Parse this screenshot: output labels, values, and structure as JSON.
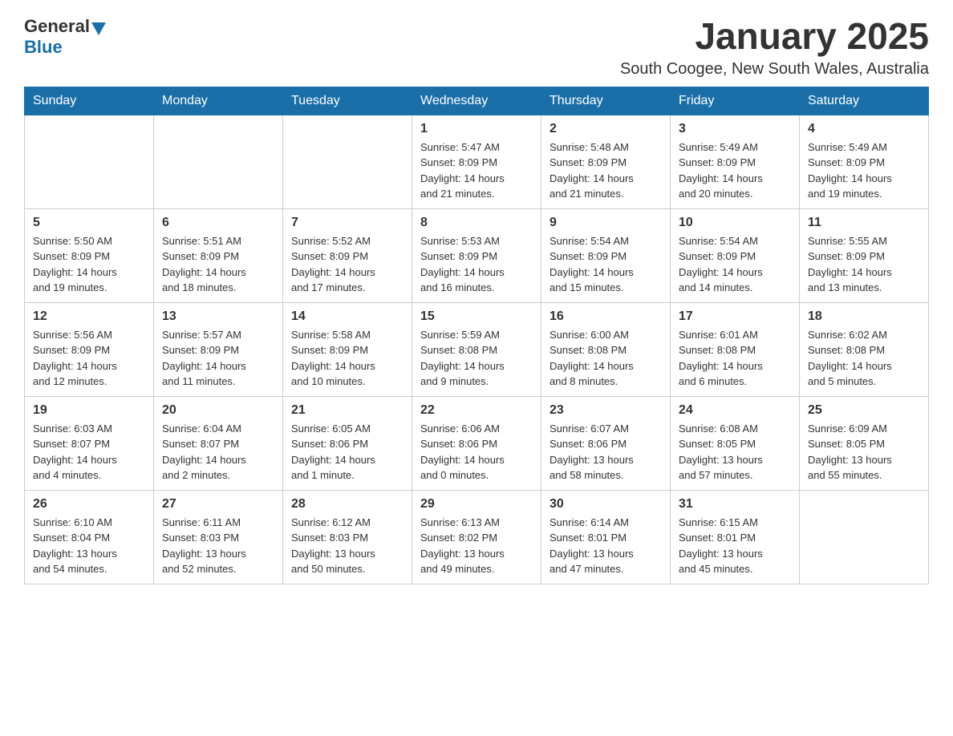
{
  "logo": {
    "general": "General",
    "blue": "Blue"
  },
  "title": "January 2025",
  "location": "South Coogee, New South Wales, Australia",
  "weekdays": [
    "Sunday",
    "Monday",
    "Tuesday",
    "Wednesday",
    "Thursday",
    "Friday",
    "Saturday"
  ],
  "weeks": [
    [
      {
        "day": "",
        "info": ""
      },
      {
        "day": "",
        "info": ""
      },
      {
        "day": "",
        "info": ""
      },
      {
        "day": "1",
        "info": "Sunrise: 5:47 AM\nSunset: 8:09 PM\nDaylight: 14 hours\nand 21 minutes."
      },
      {
        "day": "2",
        "info": "Sunrise: 5:48 AM\nSunset: 8:09 PM\nDaylight: 14 hours\nand 21 minutes."
      },
      {
        "day": "3",
        "info": "Sunrise: 5:49 AM\nSunset: 8:09 PM\nDaylight: 14 hours\nand 20 minutes."
      },
      {
        "day": "4",
        "info": "Sunrise: 5:49 AM\nSunset: 8:09 PM\nDaylight: 14 hours\nand 19 minutes."
      }
    ],
    [
      {
        "day": "5",
        "info": "Sunrise: 5:50 AM\nSunset: 8:09 PM\nDaylight: 14 hours\nand 19 minutes."
      },
      {
        "day": "6",
        "info": "Sunrise: 5:51 AM\nSunset: 8:09 PM\nDaylight: 14 hours\nand 18 minutes."
      },
      {
        "day": "7",
        "info": "Sunrise: 5:52 AM\nSunset: 8:09 PM\nDaylight: 14 hours\nand 17 minutes."
      },
      {
        "day": "8",
        "info": "Sunrise: 5:53 AM\nSunset: 8:09 PM\nDaylight: 14 hours\nand 16 minutes."
      },
      {
        "day": "9",
        "info": "Sunrise: 5:54 AM\nSunset: 8:09 PM\nDaylight: 14 hours\nand 15 minutes."
      },
      {
        "day": "10",
        "info": "Sunrise: 5:54 AM\nSunset: 8:09 PM\nDaylight: 14 hours\nand 14 minutes."
      },
      {
        "day": "11",
        "info": "Sunrise: 5:55 AM\nSunset: 8:09 PM\nDaylight: 14 hours\nand 13 minutes."
      }
    ],
    [
      {
        "day": "12",
        "info": "Sunrise: 5:56 AM\nSunset: 8:09 PM\nDaylight: 14 hours\nand 12 minutes."
      },
      {
        "day": "13",
        "info": "Sunrise: 5:57 AM\nSunset: 8:09 PM\nDaylight: 14 hours\nand 11 minutes."
      },
      {
        "day": "14",
        "info": "Sunrise: 5:58 AM\nSunset: 8:09 PM\nDaylight: 14 hours\nand 10 minutes."
      },
      {
        "day": "15",
        "info": "Sunrise: 5:59 AM\nSunset: 8:08 PM\nDaylight: 14 hours\nand 9 minutes."
      },
      {
        "day": "16",
        "info": "Sunrise: 6:00 AM\nSunset: 8:08 PM\nDaylight: 14 hours\nand 8 minutes."
      },
      {
        "day": "17",
        "info": "Sunrise: 6:01 AM\nSunset: 8:08 PM\nDaylight: 14 hours\nand 6 minutes."
      },
      {
        "day": "18",
        "info": "Sunrise: 6:02 AM\nSunset: 8:08 PM\nDaylight: 14 hours\nand 5 minutes."
      }
    ],
    [
      {
        "day": "19",
        "info": "Sunrise: 6:03 AM\nSunset: 8:07 PM\nDaylight: 14 hours\nand 4 minutes."
      },
      {
        "day": "20",
        "info": "Sunrise: 6:04 AM\nSunset: 8:07 PM\nDaylight: 14 hours\nand 2 minutes."
      },
      {
        "day": "21",
        "info": "Sunrise: 6:05 AM\nSunset: 8:06 PM\nDaylight: 14 hours\nand 1 minute."
      },
      {
        "day": "22",
        "info": "Sunrise: 6:06 AM\nSunset: 8:06 PM\nDaylight: 14 hours\nand 0 minutes."
      },
      {
        "day": "23",
        "info": "Sunrise: 6:07 AM\nSunset: 8:06 PM\nDaylight: 13 hours\nand 58 minutes."
      },
      {
        "day": "24",
        "info": "Sunrise: 6:08 AM\nSunset: 8:05 PM\nDaylight: 13 hours\nand 57 minutes."
      },
      {
        "day": "25",
        "info": "Sunrise: 6:09 AM\nSunset: 8:05 PM\nDaylight: 13 hours\nand 55 minutes."
      }
    ],
    [
      {
        "day": "26",
        "info": "Sunrise: 6:10 AM\nSunset: 8:04 PM\nDaylight: 13 hours\nand 54 minutes."
      },
      {
        "day": "27",
        "info": "Sunrise: 6:11 AM\nSunset: 8:03 PM\nDaylight: 13 hours\nand 52 minutes."
      },
      {
        "day": "28",
        "info": "Sunrise: 6:12 AM\nSunset: 8:03 PM\nDaylight: 13 hours\nand 50 minutes."
      },
      {
        "day": "29",
        "info": "Sunrise: 6:13 AM\nSunset: 8:02 PM\nDaylight: 13 hours\nand 49 minutes."
      },
      {
        "day": "30",
        "info": "Sunrise: 6:14 AM\nSunset: 8:01 PM\nDaylight: 13 hours\nand 47 minutes."
      },
      {
        "day": "31",
        "info": "Sunrise: 6:15 AM\nSunset: 8:01 PM\nDaylight: 13 hours\nand 45 minutes."
      },
      {
        "day": "",
        "info": ""
      }
    ]
  ]
}
